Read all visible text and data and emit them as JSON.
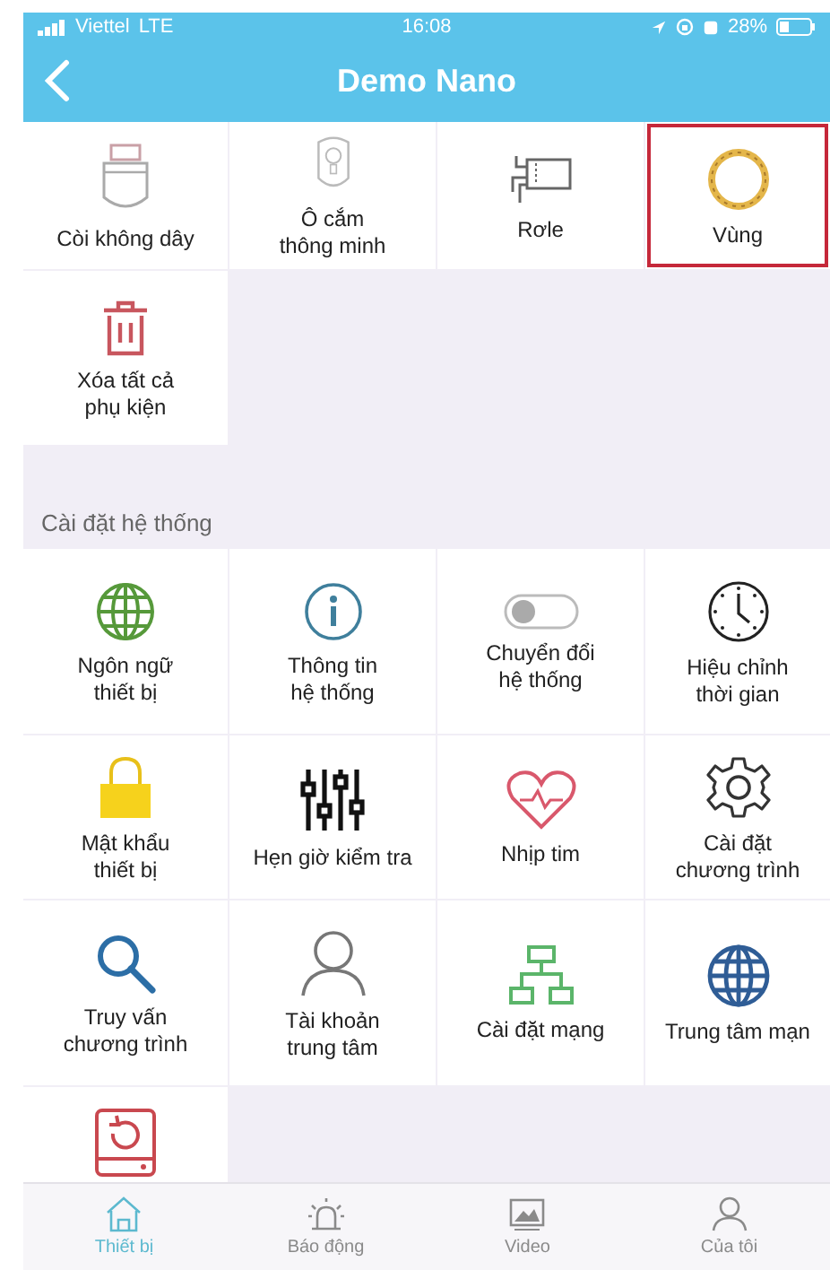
{
  "status_bar": {
    "carrier": "Viettel",
    "network": "LTE",
    "time": "16:08",
    "battery": "28%"
  },
  "nav": {
    "title": "Demo Nano"
  },
  "devices": {
    "items": [
      {
        "label": "Còi không dây",
        "highlighted": false
      },
      {
        "label": "Ô cắm\nthông minh",
        "highlighted": false
      },
      {
        "label": "Rơle",
        "highlighted": false
      },
      {
        "label": "Vùng",
        "highlighted": true
      },
      {
        "label": "Xóa tất cả\nphụ kiện",
        "highlighted": false
      }
    ]
  },
  "system_settings": {
    "title": "Cài đặt hệ thống",
    "items": [
      {
        "label": "Ngôn ngữ\nthiết bị"
      },
      {
        "label": "Thông tin\nhệ thống"
      },
      {
        "label": "Chuyển đổi\nhệ thống"
      },
      {
        "label": "Hiệu chỉnh\nthời gian"
      },
      {
        "label": "Mật khẩu\nthiết bị"
      },
      {
        "label": "Hẹn giờ kiểm tra"
      },
      {
        "label": "Nhịp tim"
      },
      {
        "label": "Cài đặt\nchương trình"
      },
      {
        "label": "Truy vấn\nchương trình"
      },
      {
        "label": "Tài khoản\ntrung tâm"
      },
      {
        "label": "Cài đặt mạng"
      },
      {
        "label": "Trung tâm mạn"
      },
      {
        "kind": "partial"
      }
    ]
  },
  "tabs": [
    {
      "label": "Thiết bị",
      "selected": true
    },
    {
      "label": "Báo động",
      "selected": false
    },
    {
      "label": "Video",
      "selected": false
    },
    {
      "label": "Của tôi",
      "selected": false
    }
  ]
}
